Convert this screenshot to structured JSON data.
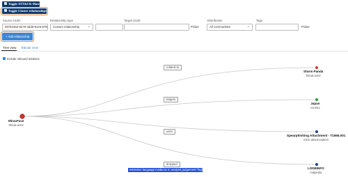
{
  "toolbar": {
    "toggle_attack_label": "Toggle ATT&CK Matrix",
    "toggle_cluster_label": "Toggle Cluster relationships"
  },
  "form": {
    "source_uuid_label": "Source UUID",
    "source_uuid_value": "08793462-8276-4dd6-9125-6790…",
    "relationship_type_label": "Relationship type",
    "relationship_type_value": "Custom relationship",
    "target_uuid_label": "Target UUID",
    "distribution_label": "Distribution",
    "distribution_value": "All communities",
    "tags_label": "Tags",
    "picker_label_1": "Picker",
    "picker_label_2": "Picker",
    "add_label": "+ Add relationship"
  },
  "tabs": [
    {
      "label": "Tree view",
      "active": true
    },
    {
      "label": "Tabular view",
      "active": false
    }
  ],
  "include_inbound_label": "Include inbound relations",
  "tree": {
    "root": {
      "name": "MiracFace",
      "type": "threat-actor",
      "color": "#d9342b"
    },
    "edges": [
      {
        "label": "related-to"
      },
      {
        "label": "targets"
      },
      {
        "label": "uses"
      },
      {
        "label": "dropped"
      }
    ],
    "targets": [
      {
        "name": "Storm Panda",
        "type": "threat-actor",
        "color": "#d9342b"
      },
      {
        "name": "Japan",
        "type": "country",
        "color": "#2d9a3a"
      },
      {
        "name": "Spearphishing Attachment - T1566.001",
        "type": "mitre-attack-pattern",
        "color": "#1c3f95"
      },
      {
        "name": "LODEINFO",
        "type": "malpedia",
        "color": "#1c3f95"
      }
    ],
    "selected_edge_text": "extensive language:evidence in analysis judgement:\"high\""
  },
  "colors": {
    "accent": "#3d85d8",
    "button_dark": "#0b3a6e",
    "focus": "#f08a24"
  }
}
